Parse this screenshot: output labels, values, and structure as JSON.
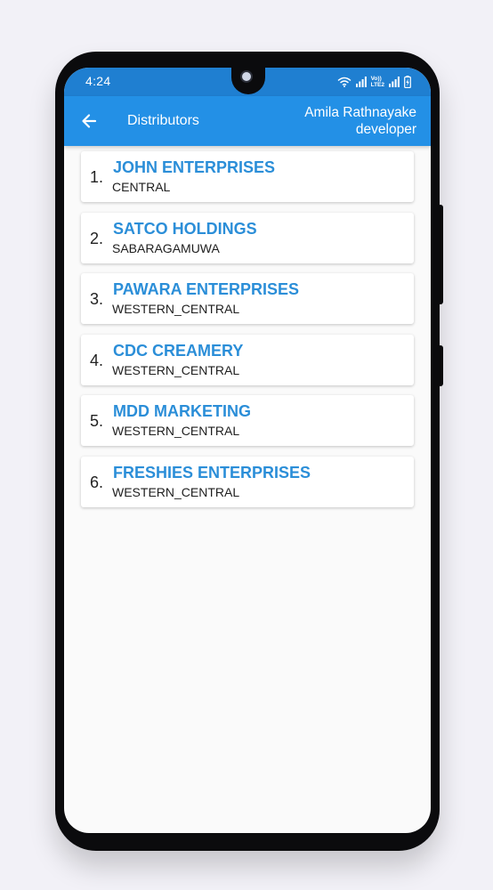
{
  "status_bar": {
    "time": "4:24",
    "icons": [
      "wifi-icon",
      "signal-icon",
      "volte-icon",
      "signal-icon",
      "battery-icon"
    ],
    "volte_line1": "Vo))",
    "volte_line2": "LTE2"
  },
  "app_bar": {
    "back_icon": "arrow-left-icon",
    "title": "Distributors",
    "user_name": "Amila Rathnayake",
    "user_role": "developer"
  },
  "distributors": [
    {
      "number": "1.",
      "name": "JOHN ENTERPRISES",
      "region": "CENTRAL"
    },
    {
      "number": "2.",
      "name": "SATCO HOLDINGS",
      "region": "SABARAGAMUWA"
    },
    {
      "number": "3.",
      "name": "PAWARA ENTERPRISES",
      "region": "WESTERN_CENTRAL"
    },
    {
      "number": "4.",
      "name": "CDC CREAMERY",
      "region": "WESTERN_CENTRAL"
    },
    {
      "number": "5.",
      "name": "MDD MARKETING",
      "region": "WESTERN_CENTRAL"
    },
    {
      "number": "6.",
      "name": "FRESHIES ENTERPRISES",
      "region": "WESTERN_CENTRAL"
    }
  ],
  "colors": {
    "app_bar": "#2390e6",
    "status_bar": "#1f7fd1",
    "distributor_name": "#2b8ed8",
    "background": "#fafafa"
  }
}
